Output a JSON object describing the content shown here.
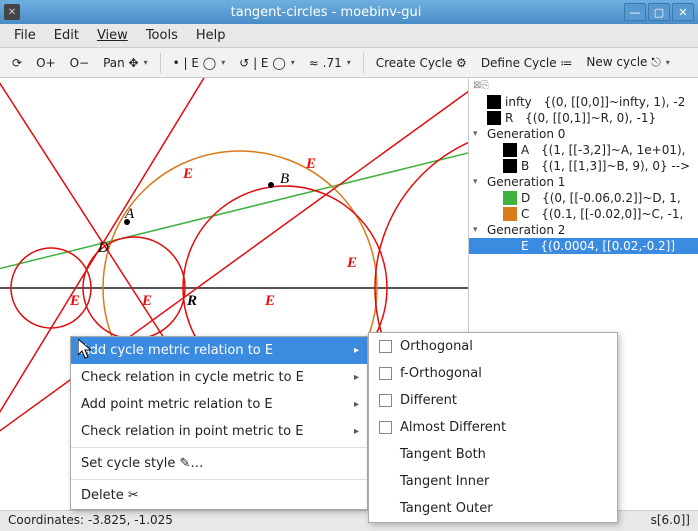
{
  "window": {
    "title": "tangent-circles - moebinv-gui"
  },
  "menubar": {
    "file": "File",
    "edit": "Edit",
    "view": "View",
    "tools": "Tools",
    "help": "Help"
  },
  "toolbar": {
    "refresh": "⟳",
    "zoom_in": "O+",
    "zoom_out": "O−",
    "pan": "Pan ✥",
    "dot_eo": "• | E ◯",
    "spiral_eo": "↺ | E ◯",
    "approx": "≈ .71",
    "create_cycle": "Create Cycle ⚙",
    "define_cycle": "Define Cycle ≔",
    "new_cycle": "New cycle ⎋"
  },
  "tree": {
    "top_icons": "⊠⎘",
    "items": [
      {
        "swatch": "#000000",
        "label": "infty",
        "detail": "{(0, [[0,0]]~infty, 1), -2"
      },
      {
        "swatch": "#000000",
        "label": "R",
        "detail": "{(0, [[0,1]]~R, 0), -1}"
      }
    ],
    "gen0": {
      "label": "Generation 0",
      "items": [
        {
          "swatch": "#000000",
          "label": "A",
          "detail": "{(1, [[-3,2]]~A, 1e+01),"
        },
        {
          "swatch": "#000000",
          "label": "B",
          "detail": "{(1, [[1,3]]~B, 9), 0} -->"
        }
      ]
    },
    "gen1": {
      "label": "Generation 1",
      "items": [
        {
          "swatch": "#3fb23f",
          "label": "D",
          "detail": "{(0, [[-0.06,0.2]]~D, 1,"
        },
        {
          "swatch": "#d97a1a",
          "label": "C",
          "detail": "{(0.1, [[-0.02,0]]~C, -1,"
        }
      ]
    },
    "gen2": {
      "label": "Generation 2",
      "items": [
        {
          "swatch": "#3b8be0",
          "label": "E",
          "detail": "{(0.0004, [[0.02,-0.2]]"
        }
      ]
    }
  },
  "canvas_labels": {
    "A": "A",
    "B": "B",
    "D": "D",
    "R": "R",
    "E": "E"
  },
  "context_menu": {
    "items": [
      "Add cycle metric relation to E",
      "Check relation in cycle metric to E",
      "Add point metric relation to E",
      "Check relation in point metric to E",
      "Set cycle style ✎…",
      "Delete ✂"
    ]
  },
  "submenu": {
    "items": [
      {
        "label": "Orthogonal",
        "check": true
      },
      {
        "label": "f-Orthogonal",
        "check": true
      },
      {
        "label": "Different",
        "check": true
      },
      {
        "label": "Almost Different",
        "check": true
      },
      {
        "label": "Tangent Both",
        "check": false
      },
      {
        "label": "Tangent Inner",
        "check": false
      },
      {
        "label": "Tangent Outer",
        "check": false
      }
    ]
  },
  "status": {
    "coords_label": "Coordinates:",
    "coords": "-3.825, -1.025",
    "right": "s[6.0]]"
  },
  "chart_data": {
    "type": "geometry",
    "title": "tangent-circles",
    "x_axis_visible_range": [
      -7,
      7
    ],
    "y_axis_visible_range": [
      -4,
      6
    ],
    "line_R": {
      "type": "line",
      "y": 0,
      "color": "#555"
    },
    "point_A": {
      "x": -3,
      "y": 2
    },
    "point_B": {
      "x": 1,
      "y": 3
    },
    "green_line_D": {
      "through": [
        "A",
        "B"
      ],
      "slope": 0.25,
      "intercept": 2.75,
      "color": "#3fb23f"
    },
    "orange_circle_C": {
      "center": [
        0.2,
        0
      ],
      "radius": 3.16,
      "color": "#d97a1a"
    },
    "red_circles_E": [
      {
        "center": [
          -5.02,
          0
        ],
        "radius": 1.17
      },
      {
        "center": [
          -2.56,
          0
        ],
        "radius": 1.46
      },
      {
        "center": [
          1.6,
          0
        ],
        "radius": 2.88
      },
      {
        "center": [
          8.8,
          0
        ],
        "radius": 4.63
      }
    ],
    "red_lines_E": [
      {
        "slope": 2.2,
        "through": [
          -4.5,
          0
        ]
      },
      {
        "slope": 0.73,
        "through": [
          -5.4,
          0
        ]
      },
      {
        "slope": -1.95,
        "through": [
          -5.56,
          0
        ]
      }
    ]
  }
}
